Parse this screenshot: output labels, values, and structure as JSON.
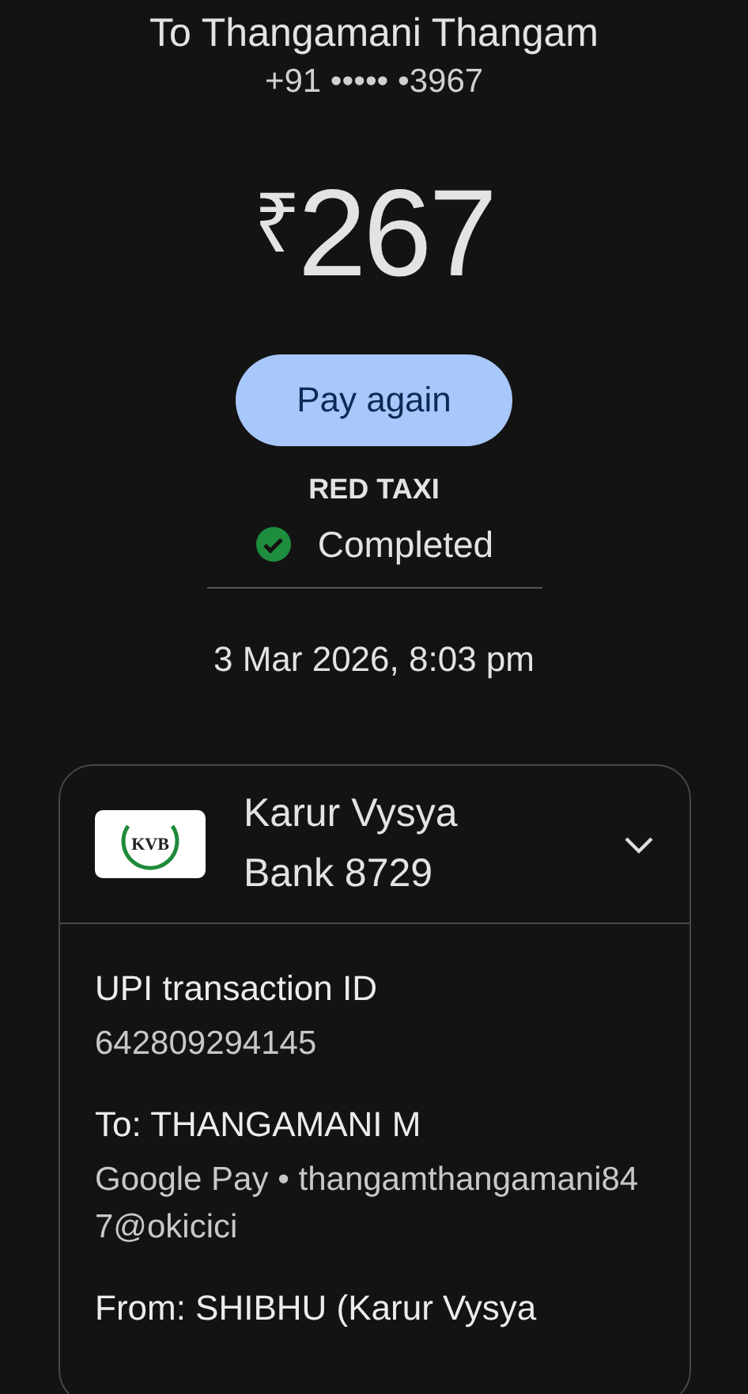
{
  "recipient": {
    "title": "To Thangamani Thangam",
    "phone": "+91 ••••• •3967"
  },
  "amount": {
    "currency": "₹",
    "value": "267"
  },
  "pay_again_button": "Pay again",
  "merchant": "RED TAXI",
  "status": {
    "kind": "success",
    "label": "Completed"
  },
  "datetime": "3 Mar 2026, 8:03 pm",
  "bank_card": {
    "logo_text": "KVB",
    "name": "Karur Vysya Bank 8729",
    "details": [
      {
        "label": "UPI transaction ID",
        "value": "642809294145"
      },
      {
        "label": "To: THANGAMANI M",
        "value": "Google Pay • thangamthangamani847@okicici"
      },
      {
        "label": "From: SHIBHU (Karur Vysya"
      }
    ]
  }
}
